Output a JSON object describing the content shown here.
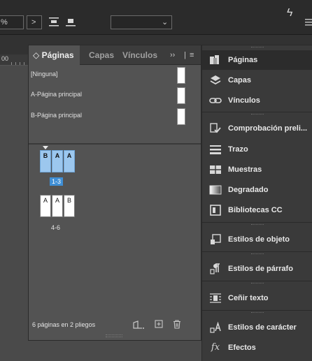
{
  "topbar": {
    "pct_text": "%",
    "next_arrow": ">",
    "dropdown_arrow": "⌄",
    "lightning": "ϟ"
  },
  "ruler": {
    "number": "00"
  },
  "pages_panel": {
    "tabs": [
      {
        "label": "Páginas",
        "prefix": "◇"
      },
      {
        "label": "Capas"
      },
      {
        "label": "Vínculos"
      }
    ],
    "tab_overflow": "››",
    "menu_icon": "≡",
    "masters": [
      {
        "label": "[Ninguna]"
      },
      {
        "label": "A-Página principal"
      },
      {
        "label": "B-Página principal"
      }
    ],
    "spreads": [
      {
        "pages": [
          "B",
          "A",
          "A"
        ],
        "label": "1-3",
        "selected": true
      },
      {
        "pages": [
          "A",
          "A",
          "B"
        ],
        "label": "4-6",
        "selected": false
      }
    ],
    "status": "6 páginas en 2 pliegos"
  },
  "dock": {
    "items": [
      {
        "label": "Páginas",
        "icon": "pages-icon",
        "active": true
      },
      {
        "label": "Capas",
        "icon": "layers-icon"
      },
      {
        "label": "Vínculos",
        "icon": "links-icon"
      },
      {
        "label": "Comprobación preli...",
        "icon": "preflight-icon"
      },
      {
        "label": "Trazo",
        "icon": "stroke-icon"
      },
      {
        "label": "Muestras",
        "icon": "swatches-icon"
      },
      {
        "label": "Degradado",
        "icon": "gradient-icon"
      },
      {
        "label": "Bibliotecas CC",
        "icon": "cc-libraries-icon"
      },
      {
        "label": "Estilos de objeto",
        "icon": "object-styles-icon"
      },
      {
        "label": "Estilos de párrafo",
        "icon": "paragraph-styles-icon"
      },
      {
        "label": "Ceñir texto",
        "icon": "text-wrap-icon"
      },
      {
        "label": "Estilos de carácter",
        "icon": "character-styles-icon"
      },
      {
        "label": "Efectos",
        "icon": "effects-icon"
      }
    ]
  }
}
